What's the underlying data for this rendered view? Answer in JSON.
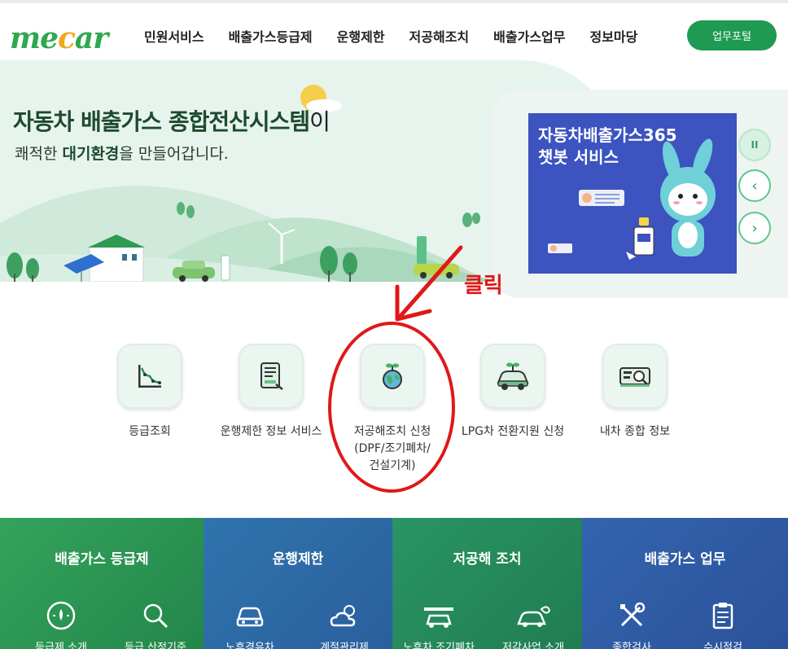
{
  "header": {
    "logo": {
      "part1": "me",
      "part2": "c",
      "part3": "ar"
    },
    "nav": [
      "민원서비스",
      "배출가스등급제",
      "운행제한",
      "저공해조치",
      "배출가스업무",
      "정보마당"
    ],
    "portal_button": "업무포털"
  },
  "hero": {
    "title_main": "자동차 배출가스 종합전산시스템",
    "title_tail": "이",
    "subtitle_pre": "쾌적한 ",
    "subtitle_bold": "대기환경",
    "subtitle_post": "을 만들어갑니다."
  },
  "promo": {
    "line1": "자동차배출가스365",
    "line2": "챗봇 서비스"
  },
  "annotation": {
    "click_label": "클릭",
    "color": "#e01818"
  },
  "quick_menu": [
    {
      "label": "등급조회",
      "icon": "chart-decline-icon"
    },
    {
      "label": "운행제한 정보 서비스",
      "icon": "document-tablet-icon"
    },
    {
      "label_lines": [
        "저공해조치 신청",
        "(DPF/조기폐차/",
        "건설기계)"
      ],
      "icon": "globe-sprout-icon"
    },
    {
      "label": "LPG차 전환지원 신청",
      "icon": "eco-car-icon"
    },
    {
      "label": "내차 종합 정보",
      "icon": "car-search-icon"
    }
  ],
  "sections": [
    {
      "title": "배출가스 등급제",
      "color": "#2f9a56",
      "items": [
        "등급제 소개",
        "등급 산정기준"
      ]
    },
    {
      "title": "운행제한",
      "color": "#2d6fa8",
      "items": [
        "노후경유차",
        "계절관리제"
      ]
    },
    {
      "title": "저공해 조치",
      "color": "#23885a",
      "items": [
        "노후차 조기폐차",
        "저감사업 소개"
      ]
    },
    {
      "title": "배출가스 업무",
      "color": "#2f5ea6",
      "items": [
        "종합검사",
        "수시점검"
      ]
    }
  ],
  "colors": {
    "brand_green": "#1f9a52",
    "logo_yellow": "#f2a81d",
    "hero_bg": "#e7f4ee",
    "promo_blue": "#3c53c0"
  }
}
